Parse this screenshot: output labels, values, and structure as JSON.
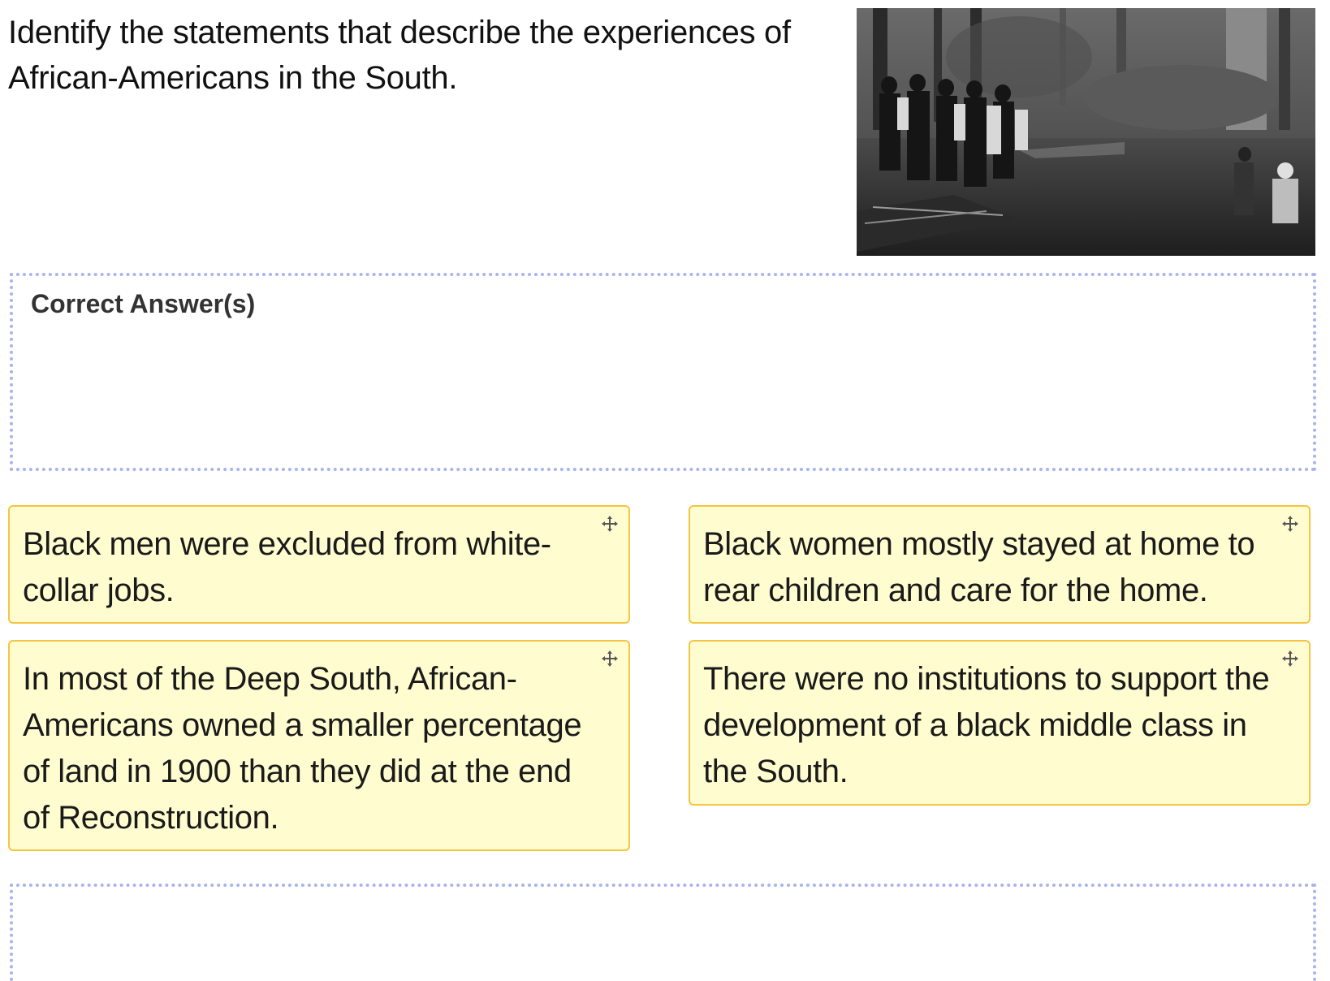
{
  "question": {
    "text": "Identify the statements that describe the experiences of African-Americans in the South."
  },
  "photo": {
    "icon": "historical-photo"
  },
  "correct_zone": {
    "title": "Correct Answer(s)"
  },
  "cards": [
    {
      "text": "Black men were excluded from white-collar jobs.",
      "icon": "move-icon"
    },
    {
      "text": "Black women mostly stayed at home to rear children and care for the home.",
      "icon": "move-icon"
    },
    {
      "text": "In most of the Deep South, African-Americans owned a smaller percentage of land in 1900 than they did at the end of Reconstruction.",
      "icon": "move-icon"
    },
    {
      "text": "There were no institutions to support the development of a black middle class in the South.",
      "icon": "move-icon"
    }
  ],
  "colors": {
    "card_bg": "#fffdd0",
    "card_border": "#f4c542",
    "dropzone_border": "#a9b3ee"
  }
}
